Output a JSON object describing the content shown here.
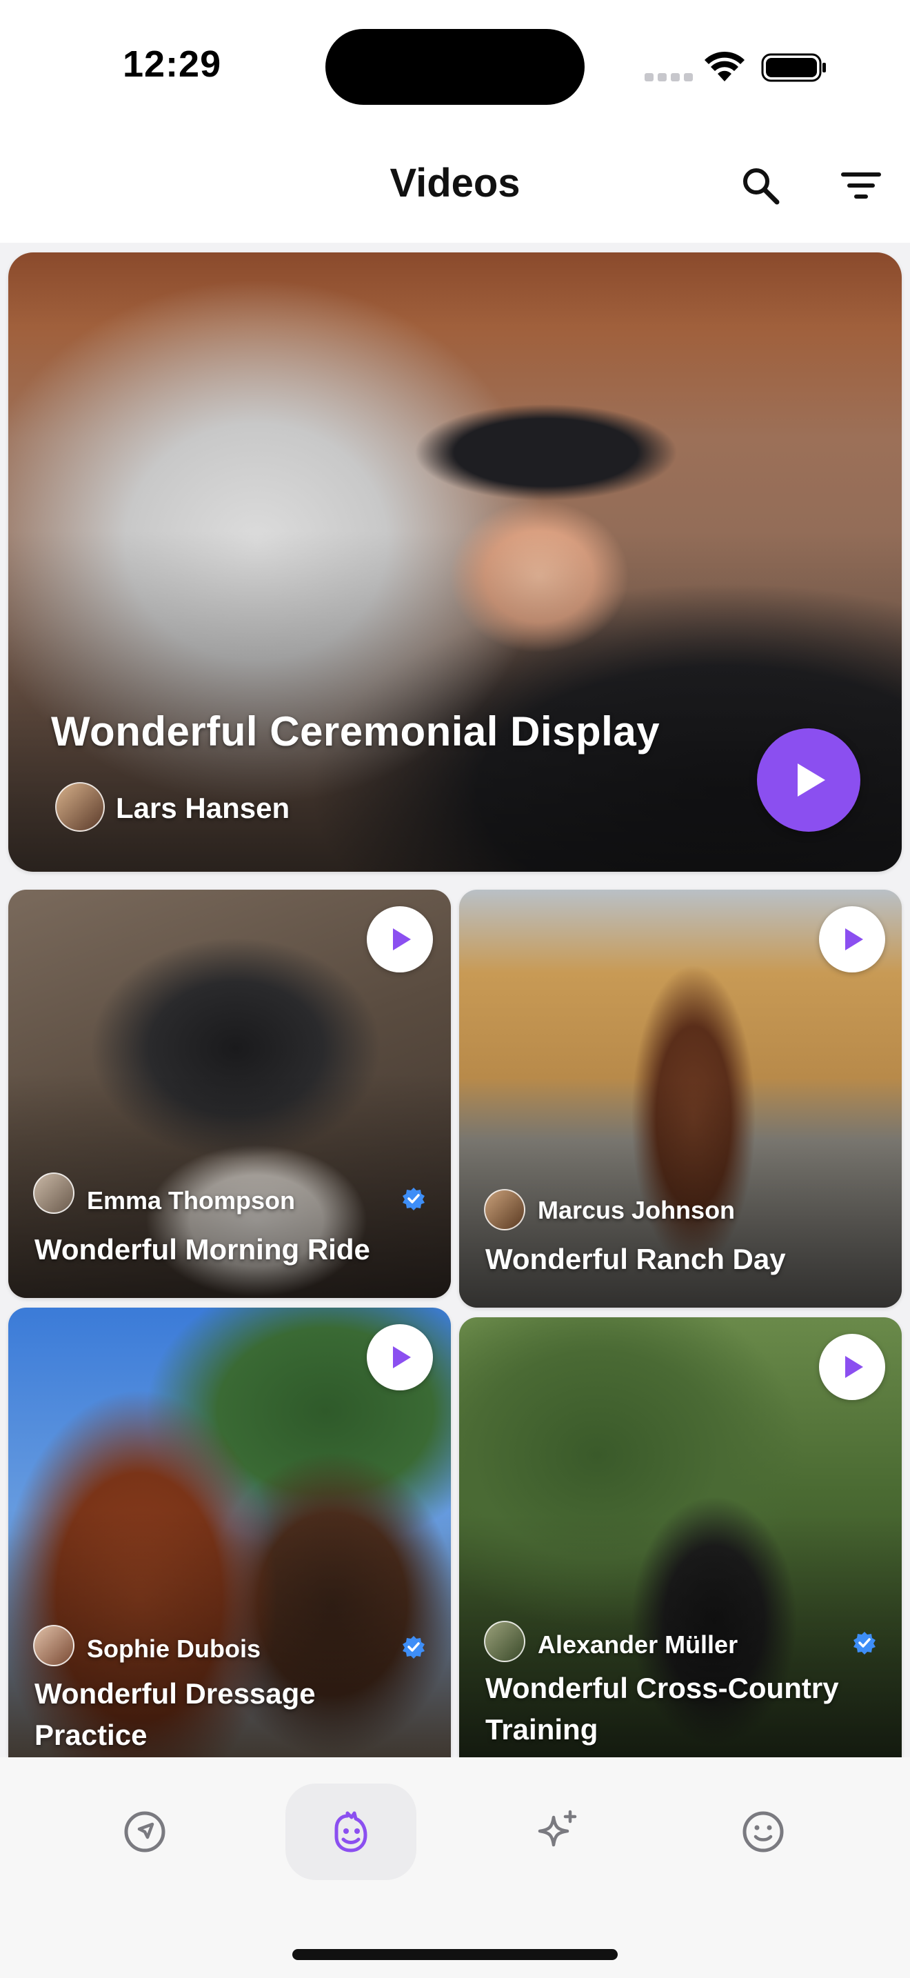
{
  "status_bar": {
    "time": "12:29"
  },
  "header": {
    "title": "Videos"
  },
  "featured": {
    "title": "Wonderful Ceremonial Display",
    "author": "Lars Hansen"
  },
  "videos": [
    {
      "author": "Emma Thompson",
      "title": "Wonderful Morning Ride",
      "verified": true
    },
    {
      "author": "Marcus Johnson",
      "title": "Wonderful Ranch Day",
      "verified": false
    },
    {
      "author": "Sophie Dubois",
      "title": "Wonderful Dressage Practice",
      "verified": true
    },
    {
      "author": "Alexander Müller",
      "title": "Wonderful Cross-Country Training",
      "verified": true
    }
  ],
  "bottom_nav": {
    "items": [
      {
        "icon": "compass-icon",
        "active": false
      },
      {
        "icon": "horse-icon",
        "active": true
      },
      {
        "icon": "sparkle-icon",
        "active": false
      },
      {
        "icon": "smiley-icon",
        "active": false
      }
    ]
  },
  "colors": {
    "accent": "#8b4ff0",
    "inactive_icon": "#7a7a80"
  }
}
